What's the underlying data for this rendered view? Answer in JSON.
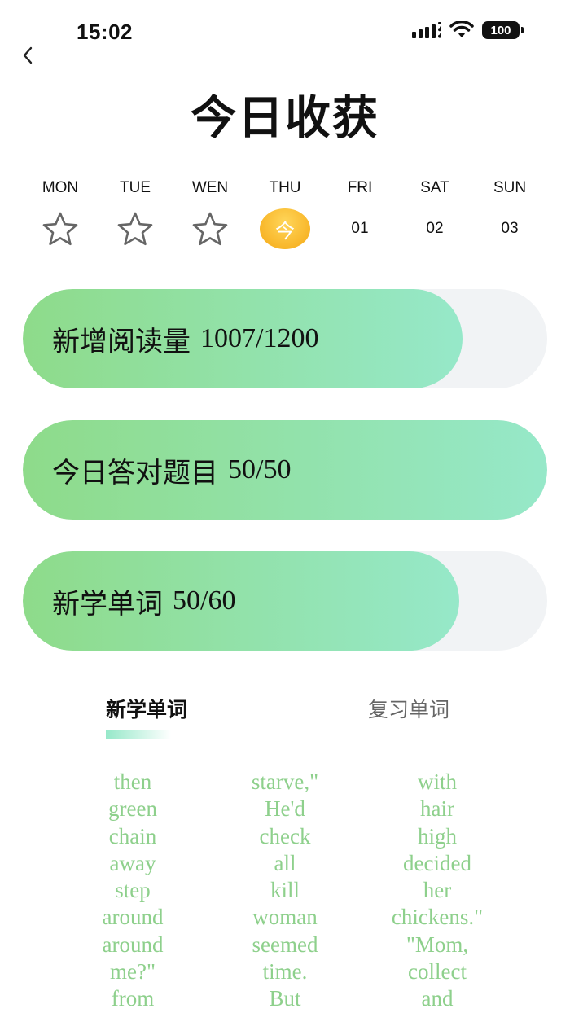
{
  "status_bar": {
    "time": "15:02",
    "battery": "100",
    "icons": [
      "signal-icon",
      "wifi-icon",
      "battery-icon"
    ]
  },
  "nav": {
    "back_icon": "chevron-left-icon"
  },
  "title": "今日收获",
  "week": [
    {
      "label": "MON",
      "mark": "star"
    },
    {
      "label": "TUE",
      "mark": "star"
    },
    {
      "label": "WEN",
      "mark": "star"
    },
    {
      "label": "THU",
      "mark": "today",
      "text": "今"
    },
    {
      "label": "FRI",
      "mark": "number",
      "text": "01"
    },
    {
      "label": "SAT",
      "mark": "number",
      "text": "02"
    },
    {
      "label": "SUN",
      "mark": "number",
      "text": "03"
    }
  ],
  "progress": [
    {
      "label": "新增阅读量",
      "value": "1007/1200",
      "fraction": 0.839
    },
    {
      "label": "今日答对题目",
      "value": "50/50",
      "fraction": 1.0
    },
    {
      "label": "新学单词",
      "value": "50/60",
      "fraction": 0.833
    }
  ],
  "tabs": {
    "new_words": "新学单词",
    "review_words": "复习单词",
    "active": "new_words"
  },
  "colors": {
    "accent_green_start": "#8edb8a",
    "accent_green_end": "#96e8c9",
    "word_green": "#8ed08c",
    "today_orange": "#f5a814",
    "track_gray": "#f1f3f5"
  },
  "words": [
    [
      "then",
      "green",
      "chain",
      "away",
      "step",
      "around",
      "around",
      "me?\"",
      "from"
    ],
    [
      "starve,\"",
      "He'd",
      "check",
      "all",
      "kill",
      "woman",
      "seemed",
      "time.",
      "But"
    ],
    [
      "with",
      "hair",
      "high",
      "decided",
      "her",
      "chickens.\"",
      "\"Mom,",
      "collect",
      "and"
    ]
  ]
}
